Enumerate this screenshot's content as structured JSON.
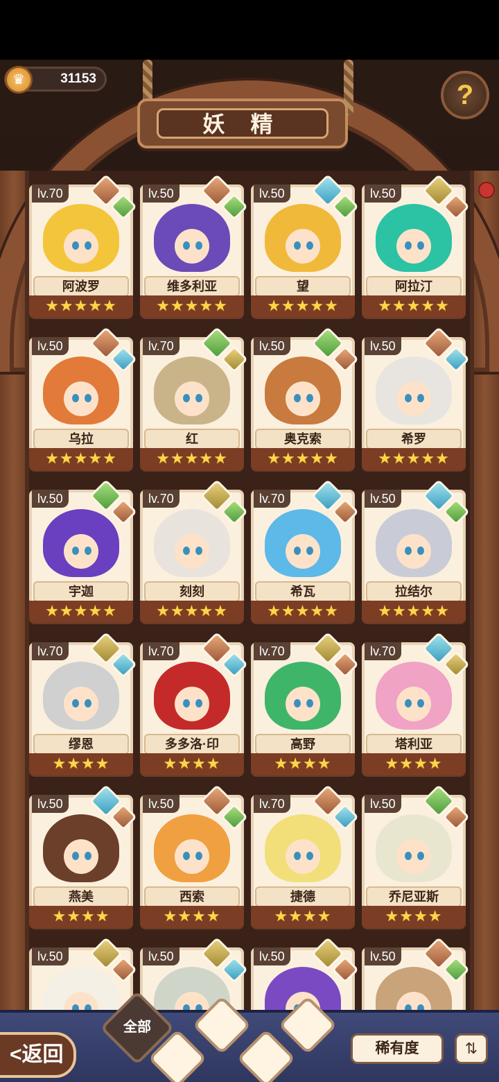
{
  "header": {
    "currency_amount": "31153",
    "title": "妖 精",
    "help_icon": "question-sprout-icon"
  },
  "fairies": [
    {
      "level": "lv.70",
      "name": "阿波罗",
      "stars": "★★★★★",
      "elements": [
        "fire",
        "leaf"
      ],
      "hair": "#f3c53a"
    },
    {
      "level": "lv.50",
      "name": "维多利亚",
      "stars": "★★★★★",
      "elements": [
        "fire",
        "leaf"
      ],
      "hair": "#6b4bb8"
    },
    {
      "level": "lv.50",
      "name": "望",
      "stars": "★★★★★",
      "elements": [
        "water",
        "leaf"
      ],
      "hair": "#f0b93a"
    },
    {
      "level": "lv.50",
      "name": "阿拉汀",
      "stars": "★★★★★",
      "elements": [
        "earth",
        "fire"
      ],
      "hair": "#2cc2a4"
    },
    {
      "level": "lv.50",
      "name": "乌拉",
      "stars": "★★★★★",
      "elements": [
        "fire",
        "water"
      ],
      "hair": "#e27a39"
    },
    {
      "level": "lv.70",
      "name": "红",
      "stars": "★★★★★",
      "elements": [
        "leaf",
        "earth"
      ],
      "hair": "#c9b48a"
    },
    {
      "level": "lv.50",
      "name": "奥克索",
      "stars": "★★★★★",
      "elements": [
        "leaf",
        "fire"
      ],
      "hair": "#c97a3f"
    },
    {
      "level": "lv.50",
      "name": "希罗",
      "stars": "★★★★★",
      "elements": [
        "fire",
        "water"
      ],
      "hair": "#e8e4df"
    },
    {
      "level": "lv.50",
      "name": "宇迦",
      "stars": "★★★★★",
      "elements": [
        "leaf",
        "fire"
      ],
      "hair": "#6a3fc0"
    },
    {
      "level": "lv.70",
      "name": "刻刻",
      "stars": "★★★★★",
      "elements": [
        "earth",
        "leaf"
      ],
      "hair": "#e9e3de"
    },
    {
      "level": "lv.70",
      "name": "希瓦",
      "stars": "★★★★★",
      "elements": [
        "water",
        "fire"
      ],
      "hair": "#5cb9e8"
    },
    {
      "level": "lv.50",
      "name": "拉结尔",
      "stars": "★★★★★",
      "elements": [
        "water",
        "leaf"
      ],
      "hair": "#c9ccd6"
    },
    {
      "level": "lv.70",
      "name": "缪恩",
      "stars": "★★★★",
      "elements": [
        "earth",
        "water"
      ],
      "hair": "#d0d0d0"
    },
    {
      "level": "lv.70",
      "name": "多多洛·印",
      "stars": "★★★★",
      "elements": [
        "fire",
        "water"
      ],
      "hair": "#c42a2a"
    },
    {
      "level": "lv.70",
      "name": "高野",
      "stars": "★★★★",
      "elements": [
        "earth",
        "fire"
      ],
      "hair": "#3fb56a"
    },
    {
      "level": "lv.70",
      "name": "塔利亚",
      "stars": "★★★★",
      "elements": [
        "water",
        "earth"
      ],
      "hair": "#f0a3c4"
    },
    {
      "level": "lv.50",
      "name": "燕美",
      "stars": "★★★★",
      "elements": [
        "water",
        "fire"
      ],
      "hair": "#6b3f2a"
    },
    {
      "level": "lv.50",
      "name": "西索",
      "stars": "★★★★",
      "elements": [
        "fire",
        "leaf"
      ],
      "hair": "#f0a040"
    },
    {
      "level": "lv.70",
      "name": "捷德",
      "stars": "★★★★",
      "elements": [
        "fire",
        "water"
      ],
      "hair": "#f2df7a"
    },
    {
      "level": "lv.50",
      "name": "乔尼亚斯",
      "stars": "★★★★",
      "elements": [
        "leaf",
        "fire"
      ],
      "hair": "#e9e6cf"
    },
    {
      "level": "lv.50",
      "name": "",
      "stars": "",
      "elements": [
        "earth",
        "fire"
      ],
      "hair": "#f4f0e6"
    },
    {
      "level": "lv.50",
      "name": "",
      "stars": "",
      "elements": [
        "earth",
        "water"
      ],
      "hair": "#cfd6c9"
    },
    {
      "level": "lv.50",
      "name": "",
      "stars": "",
      "elements": [
        "earth",
        "fire"
      ],
      "hair": "#7a4ac2"
    },
    {
      "level": "lv.50",
      "name": "",
      "stars": "",
      "elements": [
        "fire",
        "leaf"
      ],
      "hair": "#c9a37a"
    }
  ],
  "bottom": {
    "back_label": "<返回",
    "filter_all_label": "全部",
    "sort_label": "稀有度",
    "order_icon": "sort-order-icon"
  }
}
